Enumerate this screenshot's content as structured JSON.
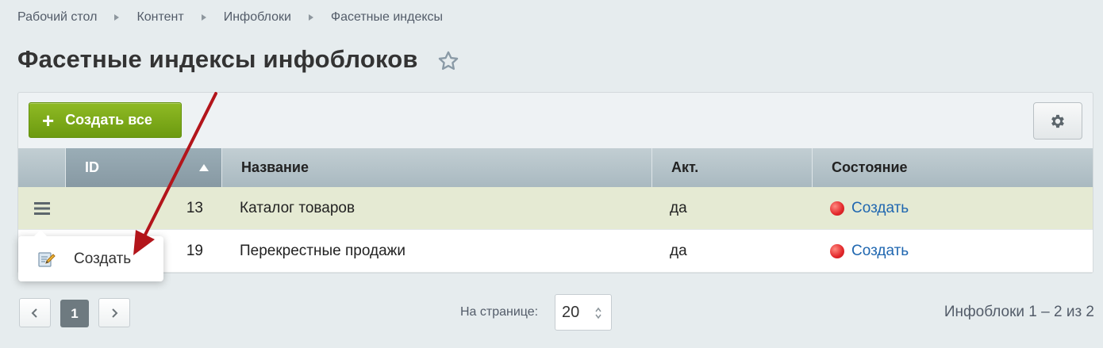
{
  "breadcrumbs": [
    "Рабочий стол",
    "Контент",
    "Инфоблоки",
    "Фасетные индексы"
  ],
  "page": {
    "title": "Фасетные индексы инфоблоков"
  },
  "toolbar": {
    "create_all_label": "Создать все",
    "plus_icon": "+"
  },
  "grid": {
    "columns": {
      "id": "ID",
      "name": "Название",
      "active": "Акт.",
      "state": "Состояние"
    },
    "rows": [
      {
        "id": "13",
        "name": "Каталог товаров",
        "active": "да",
        "state": "Создать"
      },
      {
        "id": "19",
        "name": "Перекрестные продажи",
        "active": "да",
        "state": "Создать"
      }
    ]
  },
  "context_menu": {
    "item_label": "Создать"
  },
  "pagination": {
    "current_page": "1",
    "per_page_label": "На странице:",
    "per_page_value": "20",
    "total": "Инфоблоки 1 – 2 из 2"
  },
  "colors": {
    "create_button": "#7aa818",
    "selected_row": "#e5ead3",
    "status_dot": "#e2262a",
    "link": "#2067b0",
    "annotation_arrow": "#b3151b"
  },
  "icons": {
    "breadcrumb_separator": "triangle-right-icon",
    "favorite": "star-outline-icon",
    "settings": "gear-icon",
    "row_menu": "hamburger-menu-icon",
    "menu_item": "edit-pencil-icon",
    "sort": "sort-asc-icon"
  }
}
